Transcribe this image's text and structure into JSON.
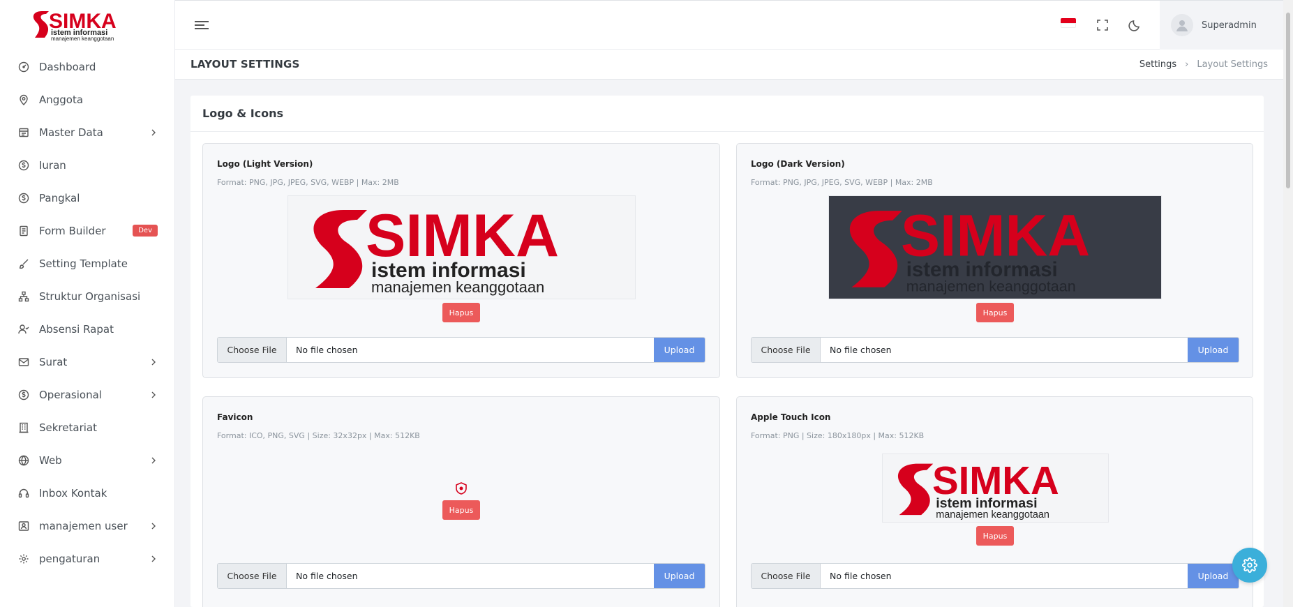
{
  "brand": {
    "logo_main": "SIMKA",
    "logo_line1": "istem informasi",
    "logo_line2": "manajemen keanggotaan"
  },
  "sidebar": {
    "items": [
      {
        "label": "Dashboard",
        "icon": "dashboard-icon",
        "has_submenu": false
      },
      {
        "label": "Anggota",
        "icon": "location-pin-icon",
        "has_submenu": false
      },
      {
        "label": "Master Data",
        "icon": "database-icon",
        "has_submenu": true
      },
      {
        "label": "Iuran",
        "icon": "coin-icon",
        "has_submenu": false
      },
      {
        "label": "Pangkal",
        "icon": "coin-icon",
        "has_submenu": false
      },
      {
        "label": "Form Builder",
        "icon": "form-icon",
        "has_submenu": false,
        "badge": "Dev"
      },
      {
        "label": "Setting Template",
        "icon": "brush-icon",
        "has_submenu": false
      },
      {
        "label": "Struktur Organisasi",
        "icon": "org-chart-icon",
        "has_submenu": false
      },
      {
        "label": "Absensi Rapat",
        "icon": "user-check-icon",
        "has_submenu": false
      },
      {
        "label": "Surat",
        "icon": "mail-icon",
        "has_submenu": true
      },
      {
        "label": "Operasional",
        "icon": "coin-icon",
        "has_submenu": true
      },
      {
        "label": "Sekretariat",
        "icon": "building-icon",
        "has_submenu": false
      },
      {
        "label": "Web",
        "icon": "globe-icon",
        "has_submenu": true
      },
      {
        "label": "Inbox Kontak",
        "icon": "headset-icon",
        "has_submenu": false
      },
      {
        "label": "manajemen user",
        "icon": "user-card-icon",
        "has_submenu": true
      },
      {
        "label": "pengaturan",
        "icon": "gear-icon",
        "has_submenu": true
      }
    ]
  },
  "topbar": {
    "user_name": "Superadmin",
    "language_flag": "indonesia-flag-icon"
  },
  "page": {
    "title": "LAYOUT SETTINGS",
    "breadcrumb": [
      "Settings",
      "Layout Settings"
    ]
  },
  "card": {
    "title": "Logo & Icons",
    "panels": [
      {
        "title": "Logo (Light Version)",
        "format": "Format: PNG, JPG, JPEG, SVG, WEBP | Max: 2MB",
        "delete_label": "Hapus",
        "choose_label": "Choose File",
        "file_status": "No file chosen",
        "upload_label": "Upload"
      },
      {
        "title": "Logo (Dark Version)",
        "format": "Format: PNG, JPG, JPEG, SVG, WEBP | Max: 2MB",
        "delete_label": "Hapus",
        "choose_label": "Choose File",
        "file_status": "No file chosen",
        "upload_label": "Upload"
      },
      {
        "title": "Favicon",
        "format": "Format: ICO, PNG, SVG | Size: 32x32px | Max: 512KB",
        "delete_label": "Hapus",
        "choose_label": "Choose File",
        "file_status": "No file chosen",
        "upload_label": "Upload"
      },
      {
        "title": "Apple Touch Icon",
        "format": "Format: PNG | Size: 180x180px | Max: 512KB",
        "delete_label": "Hapus",
        "choose_label": "Choose File",
        "file_status": "No file chosen",
        "upload_label": "Upload"
      }
    ]
  },
  "colors": {
    "brand_red": "#d6001c",
    "accent_blue": "#6491e5",
    "danger": "#ec5a5a",
    "fab": "#3bafda"
  }
}
